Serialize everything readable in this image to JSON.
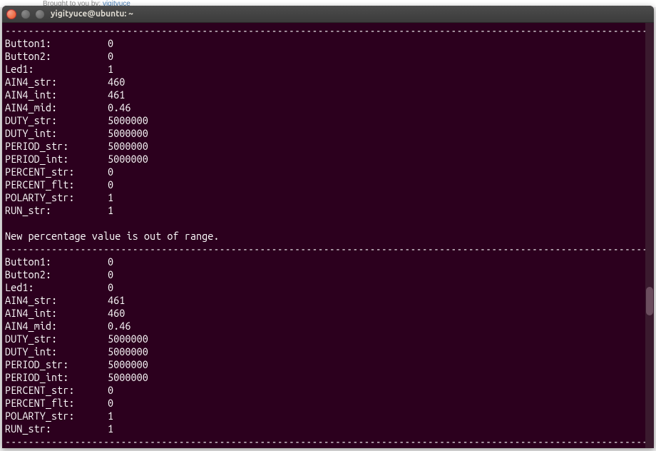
{
  "page_background": {
    "text_prefix": "Brought to you by: ",
    "link_text": "vigitvuce"
  },
  "window": {
    "title": "yigityuce@ubuntu: ~"
  },
  "terminal": {
    "divider": "---------------------------------------------------------------------------------------------------------------",
    "block1": {
      "rows": [
        {
          "label": "Button1:",
          "value": "0"
        },
        {
          "label": "Button2:",
          "value": "0"
        },
        {
          "label": "Led1:",
          "value": "1"
        },
        {
          "label": "AIN4_str:",
          "value": "460"
        },
        {
          "label": "AIN4_int:",
          "value": "461"
        },
        {
          "label": "AIN4_mid:",
          "value": "0.46"
        },
        {
          "label": "DUTY_str:",
          "value": "5000000"
        },
        {
          "label": "DUTY_int:",
          "value": "5000000"
        },
        {
          "label": "PERIOD_str:",
          "value": "5000000"
        },
        {
          "label": "PERIOD_int:",
          "value": "5000000"
        },
        {
          "label": "PERCENT_str:",
          "value": "0"
        },
        {
          "label": "PERCENT_flt:",
          "value": "0"
        },
        {
          "label": "POLARTY_str:",
          "value": "1"
        },
        {
          "label": "RUN_str:",
          "value": "1"
        }
      ]
    },
    "message": "New percentage value is out of range.",
    "block2": {
      "rows": [
        {
          "label": "Button1:",
          "value": "0"
        },
        {
          "label": "Button2:",
          "value": "0"
        },
        {
          "label": "Led1:",
          "value": "0"
        },
        {
          "label": "AIN4_str:",
          "value": "461"
        },
        {
          "label": "AIN4_int:",
          "value": "460"
        },
        {
          "label": "AIN4_mid:",
          "value": "0.46"
        },
        {
          "label": "DUTY_str:",
          "value": "5000000"
        },
        {
          "label": "DUTY_int:",
          "value": "5000000"
        },
        {
          "label": "PERIOD_str:",
          "value": "5000000"
        },
        {
          "label": "PERIOD_int:",
          "value": "5000000"
        },
        {
          "label": "PERCENT_str:",
          "value": "0"
        },
        {
          "label": "PERCENT_flt:",
          "value": "0"
        },
        {
          "label": "POLARTY_str:",
          "value": "1"
        },
        {
          "label": "RUN_str:",
          "value": "1"
        }
      ]
    }
  }
}
